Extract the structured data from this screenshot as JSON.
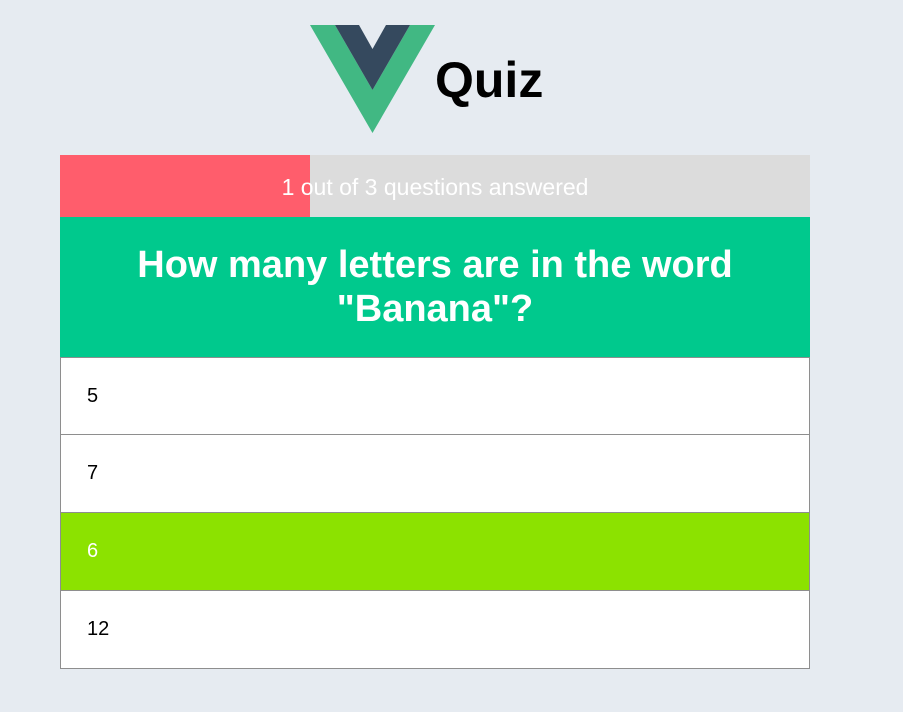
{
  "header": {
    "title": "Quiz",
    "logo_icon": "vue-logo-icon",
    "logo_colors": {
      "outer": "#41b883",
      "inner": "#35495e"
    }
  },
  "progress": {
    "text": "1 out of 3 questions answered",
    "answered": 1,
    "total": 3,
    "fill_color": "#ff5d6c",
    "track_color": "#dcdcdc"
  },
  "question": {
    "text": "How many letters are in the word \"Banana\"?",
    "background": "#00c98d"
  },
  "answers": [
    {
      "label": "5",
      "selected": false
    },
    {
      "label": "7",
      "selected": false
    },
    {
      "label": "6",
      "selected": true
    },
    {
      "label": "12",
      "selected": false
    }
  ],
  "colors": {
    "page_background": "#e6ebf1",
    "selected_answer": "#8ce200"
  }
}
